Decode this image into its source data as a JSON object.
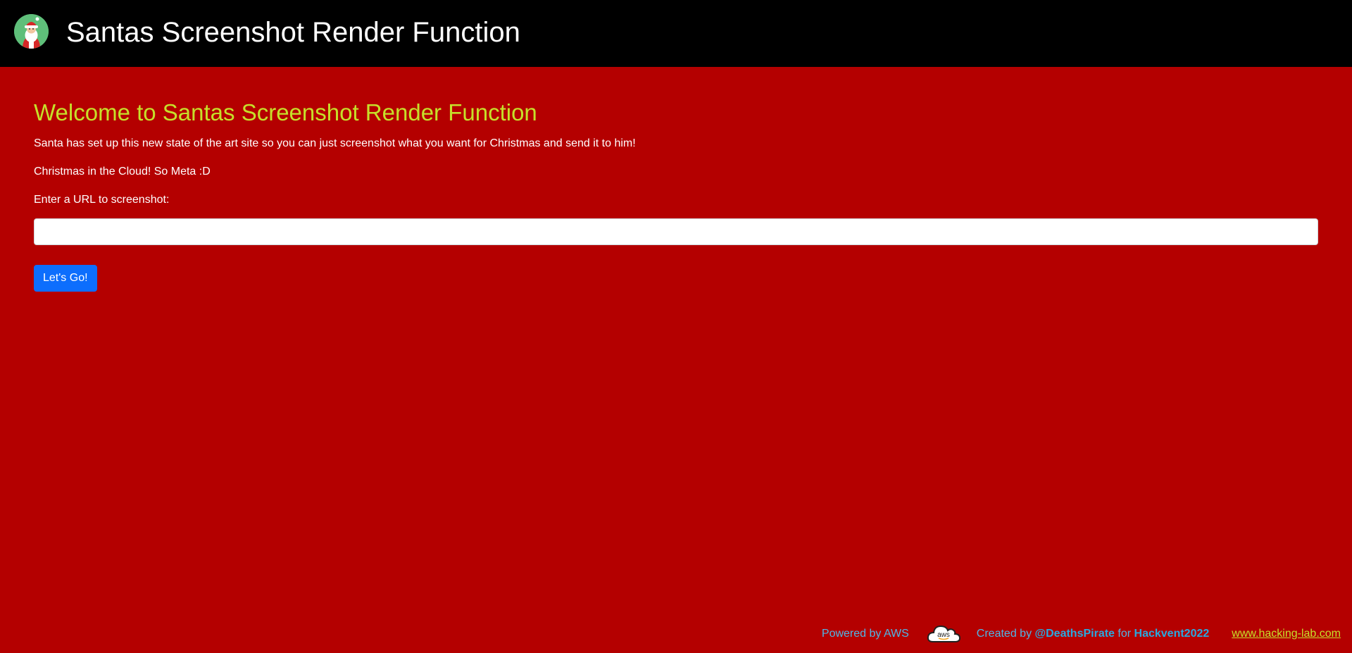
{
  "header": {
    "title": "Santas Screenshot Render Function"
  },
  "main": {
    "heading": "Welcome to Santas Screenshot Render Function",
    "intro": "Santa has set up this new state of the art site so you can just screenshot what you want for Christmas and send it to him!",
    "tagline": "Christmas in the Cloud! So Meta :D",
    "url_label": "Enter a URL to screenshot:",
    "url_value": "",
    "submit_label": "Let's Go!"
  },
  "footer": {
    "powered_by": "Powered by AWS",
    "aws_logo_text": "aws",
    "created_by_prefix": "Created by",
    "author": "@DeathsPirate",
    "for_text": "for",
    "event": "Hackvent2022",
    "site_link": "www.hacking-lab.com"
  },
  "colors": {
    "background": "#b40000",
    "navbar": "#000000",
    "heading": "#c6e02a",
    "button": "#0d6efd",
    "footer_text": "#4fb6e6",
    "link": "#c6e02a"
  },
  "icons": {
    "logo": "santa-avatar-icon",
    "aws": "aws-cloud-icon"
  }
}
